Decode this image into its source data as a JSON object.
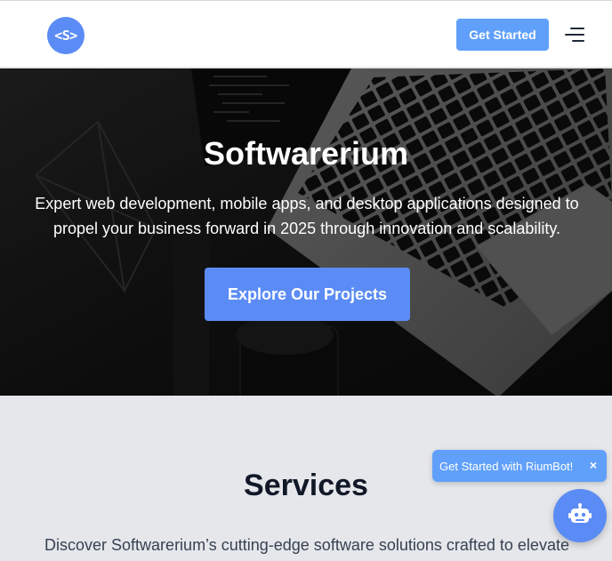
{
  "header": {
    "logo_text": "<S>",
    "get_started_label": "Get Started",
    "menu_icon": "hamburger-menu-icon"
  },
  "hero": {
    "title": "Softwarerium",
    "subtitle": "Expert web development, mobile apps, and desktop applications designed to propel your business forward in 2025 through innovation and scalability.",
    "cta_label": "Explore Our Projects",
    "background_image": "laptop-keyboard-photo"
  },
  "services": {
    "title": "Services",
    "description": "Discover Softwarerium’s cutting-edge software solutions crafted to elevate"
  },
  "chat": {
    "prompt_label": "Get Started with RiumBot!",
    "close_symbol": "×",
    "fab_icon": "robot-icon"
  },
  "colors": {
    "accent": "#5b8cf5",
    "button": "#60a0fa",
    "section_bg": "#e5e7eb"
  }
}
